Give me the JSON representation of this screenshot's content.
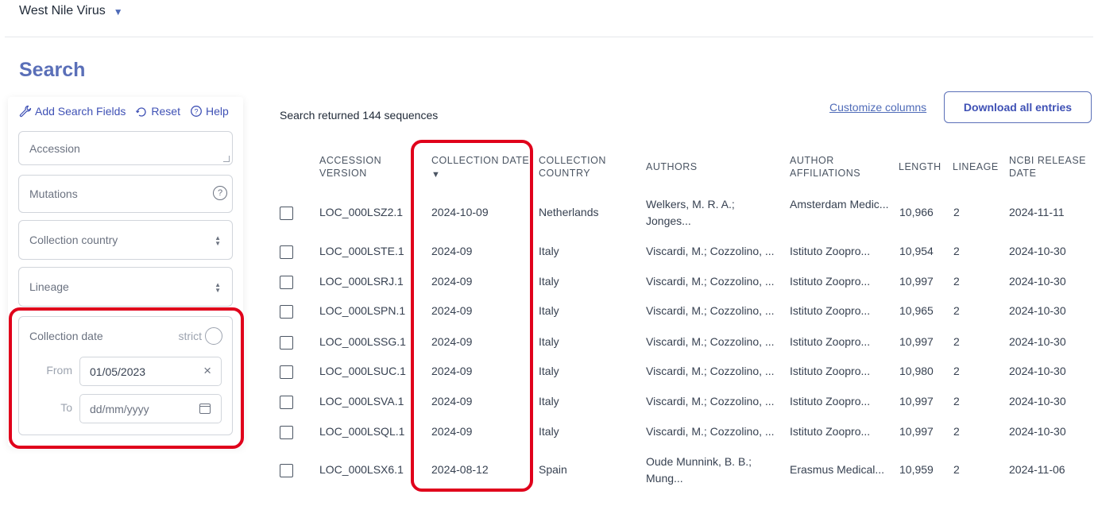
{
  "header": {
    "virus": "West Nile Virus"
  },
  "page_title": "Search",
  "sidebar": {
    "tools": {
      "add": "Add Search Fields",
      "reset": "Reset",
      "help": "Help"
    },
    "accession_placeholder": "Accession",
    "mutations_placeholder": "Mutations",
    "country_placeholder": "Collection country",
    "lineage_placeholder": "Lineage",
    "date": {
      "label": "Collection date",
      "strict": "strict",
      "from_label": "From",
      "from_value": "01/05/2023",
      "to_label": "To",
      "to_placeholder": "dd/mm/yyyy"
    }
  },
  "results": {
    "count_text": "Search returned 144 sequences",
    "customize": "Customize columns",
    "download": "Download all entries",
    "headers": {
      "accession_l1": "ACCESSION",
      "accession_l2": "VERSION",
      "date_l1": "COLLECTION DATE",
      "country_l1": "COLLECTION",
      "country_l2": "COUNTRY",
      "authors": "AUTHORS",
      "aff_l1": "AUTHOR",
      "aff_l2": "AFFILIATIONS",
      "length": "LENGTH",
      "lineage": "LINEAGE",
      "release_l1": "NCBI RELEASE",
      "release_l2": "DATE"
    },
    "rows": [
      {
        "accession": "LOC_000LSZ2.1",
        "date": "2024-10-09",
        "country": "Netherlands",
        "authors": "Welkers, M. R. A.; Jonges...",
        "affiliations": "Amsterdam Medic...",
        "length": "10,966",
        "lineage": "2",
        "release": "2024-11-11"
      },
      {
        "accession": "LOC_000LSTE.1",
        "date": "2024-09",
        "country": "Italy",
        "authors": "Viscardi, M.; Cozzolino, ...",
        "affiliations": "Istituto Zoopro...",
        "length": "10,954",
        "lineage": "2",
        "release": "2024-10-30"
      },
      {
        "accession": "LOC_000LSRJ.1",
        "date": "2024-09",
        "country": "Italy",
        "authors": "Viscardi, M.; Cozzolino, ...",
        "affiliations": "Istituto Zoopro...",
        "length": "10,997",
        "lineage": "2",
        "release": "2024-10-30"
      },
      {
        "accession": "LOC_000LSPN.1",
        "date": "2024-09",
        "country": "Italy",
        "authors": "Viscardi, M.; Cozzolino, ...",
        "affiliations": "Istituto Zoopro...",
        "length": "10,965",
        "lineage": "2",
        "release": "2024-10-30"
      },
      {
        "accession": "LOC_000LSSG.1",
        "date": "2024-09",
        "country": "Italy",
        "authors": "Viscardi, M.; Cozzolino, ...",
        "affiliations": "Istituto Zoopro...",
        "length": "10,997",
        "lineage": "2",
        "release": "2024-10-30"
      },
      {
        "accession": "LOC_000LSUC.1",
        "date": "2024-09",
        "country": "Italy",
        "authors": "Viscardi, M.; Cozzolino, ...",
        "affiliations": "Istituto Zoopro...",
        "length": "10,980",
        "lineage": "2",
        "release": "2024-10-30"
      },
      {
        "accession": "LOC_000LSVA.1",
        "date": "2024-09",
        "country": "Italy",
        "authors": "Viscardi, M.; Cozzolino, ...",
        "affiliations": "Istituto Zoopro...",
        "length": "10,997",
        "lineage": "2",
        "release": "2024-10-30"
      },
      {
        "accession": "LOC_000LSQL.1",
        "date": "2024-09",
        "country": "Italy",
        "authors": "Viscardi, M.; Cozzolino, ...",
        "affiliations": "Istituto Zoopro...",
        "length": "10,997",
        "lineage": "2",
        "release": "2024-10-30"
      },
      {
        "accession": "LOC_000LSX6.1",
        "date": "2024-08-12",
        "country": "Spain",
        "authors": "Oude Munnink, B. B.; Mung...",
        "affiliations": "Erasmus Medical...",
        "length": "10,959",
        "lineage": "2",
        "release": "2024-11-06"
      }
    ]
  },
  "colors": {
    "accent": "#5a6fb8",
    "link": "#3f51b5",
    "highlight": "#e0001b"
  }
}
